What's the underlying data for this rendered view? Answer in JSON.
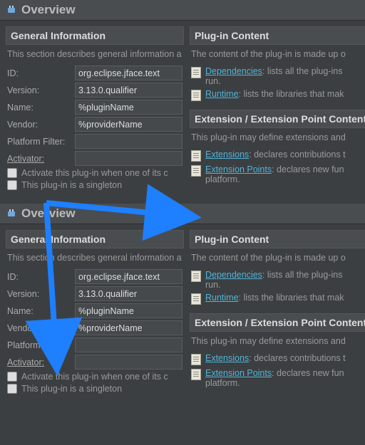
{
  "title": "Overview",
  "general": {
    "header": "General Information",
    "desc": "This section describes general information a",
    "labels": {
      "id": "ID:",
      "version": "Version:",
      "name": "Name:",
      "vendor": "Vendor:",
      "platform_filter": "Platform Filter:",
      "activator": "Activator:"
    },
    "values": {
      "id": "org.eclipse.jface.text",
      "version": "3.13.0.qualifier",
      "name": "%pluginName",
      "vendor": "%providerName",
      "platform_filter": "",
      "activator": ""
    },
    "checkboxes": {
      "activate": "Activate this plug-in when one of its c",
      "singleton": "This plug-in is a singleton"
    }
  },
  "plugin_content": {
    "header": "Plug-in Content",
    "desc": "The content of the plug-in is made up o",
    "dependencies": {
      "link": "Dependencies",
      "text": ": lists all the plug-ins"
    },
    "dependencies_tail": "run.",
    "runtime": {
      "link": "Runtime",
      "text": ": lists the libraries that mak"
    }
  },
  "extension_content": {
    "header": "Extension / Extension Point Content",
    "desc": "This plug-in may define extensions and",
    "extensions": {
      "link": "Extensions",
      "text": ": declares contributions t"
    },
    "extension_points": {
      "link": "Extension Points",
      "text": ": declares new fun"
    },
    "extension_points_tail": "platform."
  }
}
